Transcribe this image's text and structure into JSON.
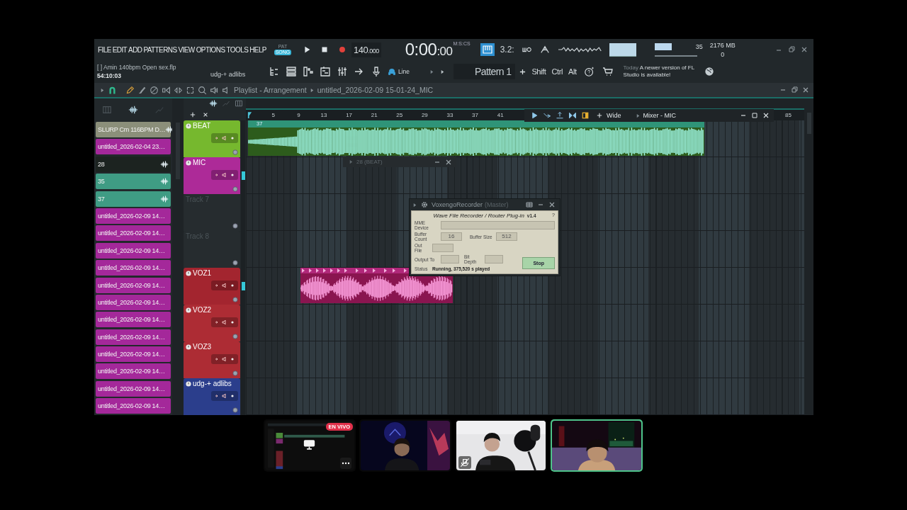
{
  "menu": [
    "FILE",
    "EDIT",
    "ADD",
    "PATTERNS",
    "VIEW",
    "OPTIONS",
    "TOOLS",
    "HELP"
  ],
  "transport": {
    "pat_label": "PAT",
    "song_label": "SONG",
    "song_mode": true,
    "tempo": "140",
    "tempo_fraction": ".000",
    "time": "0:00",
    "time_fraction": ":00",
    "time_unit": "M:S:CS",
    "snap": "3.2:"
  },
  "monitor": {
    "cpu": "35",
    "memory": "2176 MB",
    "polyphony": "0"
  },
  "project": {
    "file": "[   ] Amin 140bpm Open sex.flp",
    "elapsed": "54:10:03",
    "channel": "udg-+ adlibs"
  },
  "input": "Line",
  "pattern": "Pattern 1",
  "modifiers": [
    "Shift",
    "Ctrl",
    "Alt"
  ],
  "news": {
    "when": "Today",
    "text": "A newer version of FL Studio is available!"
  },
  "playlist": {
    "title": "Playlist - Arrangement",
    "breadcrumb": "untitled_2026-02-09 15-01-24_MIC"
  },
  "picker": [
    {
      "label": "SLURP Cm 116BPM D…",
      "kind": "audio",
      "color": "#8b8f7a"
    },
    {
      "label": "untitled_2026-02-04 23…",
      "kind": "pattern",
      "color": "#a4289a"
    },
    {
      "label": "28",
      "kind": "audio",
      "color": "#1c2320"
    },
    {
      "label": "35",
      "kind": "audio",
      "color": "#3f9c84"
    },
    {
      "label": "37",
      "kind": "audio",
      "color": "#3f9c84"
    },
    {
      "label": "untitled_2026-02-09 14…",
      "kind": "pattern",
      "color": "#a4289a"
    },
    {
      "label": "untitled_2026-02-09 14…",
      "kind": "pattern",
      "color": "#a4289a"
    },
    {
      "label": "untitled_2026-02-09 14…",
      "kind": "pattern",
      "color": "#a4289a"
    },
    {
      "label": "untitled_2026-02-09 14…",
      "kind": "pattern",
      "color": "#a4289a"
    },
    {
      "label": "untitled_2026-02-09 14…",
      "kind": "pattern",
      "color": "#a4289a"
    },
    {
      "label": "untitled_2026-02-09 14…",
      "kind": "pattern",
      "color": "#a4289a"
    },
    {
      "label": "untitled_2026-02-09 14…",
      "kind": "pattern",
      "color": "#a4289a"
    },
    {
      "label": "untitled_2026-02-09 14…",
      "kind": "pattern",
      "color": "#a4289a"
    },
    {
      "label": "untitled_2026-02-09 14…",
      "kind": "pattern",
      "color": "#a4289a"
    },
    {
      "label": "untitled_2026-02-09 14…",
      "kind": "pattern",
      "color": "#a4289a"
    },
    {
      "label": "untitled_2026-02-09 14…",
      "kind": "pattern",
      "color": "#a4289a"
    },
    {
      "label": "untitled_2026-02-09 14…",
      "kind": "pattern",
      "color": "#a4289a"
    }
  ],
  "ruler": [
    "5",
    "9",
    "13",
    "17",
    "21",
    "25",
    "29",
    "33",
    "37",
    "41",
    "85"
  ],
  "mixer_bar": {
    "label": "Wide",
    "title": "Mixer - MIC"
  },
  "tracks": [
    {
      "name": "BEAT",
      "color": "#76b82e",
      "active": false,
      "clip": {
        "kind": "beat",
        "label": "37"
      }
    },
    {
      "name": "MIC",
      "color": "#ad2a98",
      "active": true
    },
    {
      "name": "Track 7",
      "active": false
    },
    {
      "name": "Track 8",
      "active": false
    },
    {
      "name": "VOZ1",
      "color": "#a3252f",
      "active": true,
      "clip": {
        "kind": "vocal"
      }
    },
    {
      "name": "VOZ2",
      "color": "#ad2c34",
      "active": false
    },
    {
      "name": "VOZ3",
      "color": "#ad2c34",
      "active": false
    },
    {
      "name": "udg-+ adlibs",
      "color": "#2b3e8c",
      "active": false
    }
  ],
  "floating_panel": {
    "title": "28 (BEAT)"
  },
  "recorder": {
    "title": "VoxengoRecorder",
    "subtitle": "(Master)",
    "heading": "Wave File Recorder / Router Plug-in",
    "version": "v1.4",
    "help": "?",
    "labels": {
      "device": "MME Device",
      "buffer_count": "Buffer Count",
      "buffer_size": "Buffer Size",
      "out_file": "Out File",
      "output_to": "Output To",
      "bit_depth": "Bit Depth",
      "status": "Status"
    },
    "buffer_count": "16",
    "buffer_size": "512",
    "status": "Running, 375,520 s played",
    "button": "Stop"
  },
  "call": {
    "live_badge": "EN VIVO",
    "tiles": [
      {
        "kind": "screen",
        "selected": false,
        "muted": false
      },
      {
        "kind": "camera",
        "selected": false,
        "muted": false
      },
      {
        "kind": "camera",
        "selected": false,
        "muted": true
      },
      {
        "kind": "camera",
        "selected": true,
        "muted": false
      }
    ]
  }
}
